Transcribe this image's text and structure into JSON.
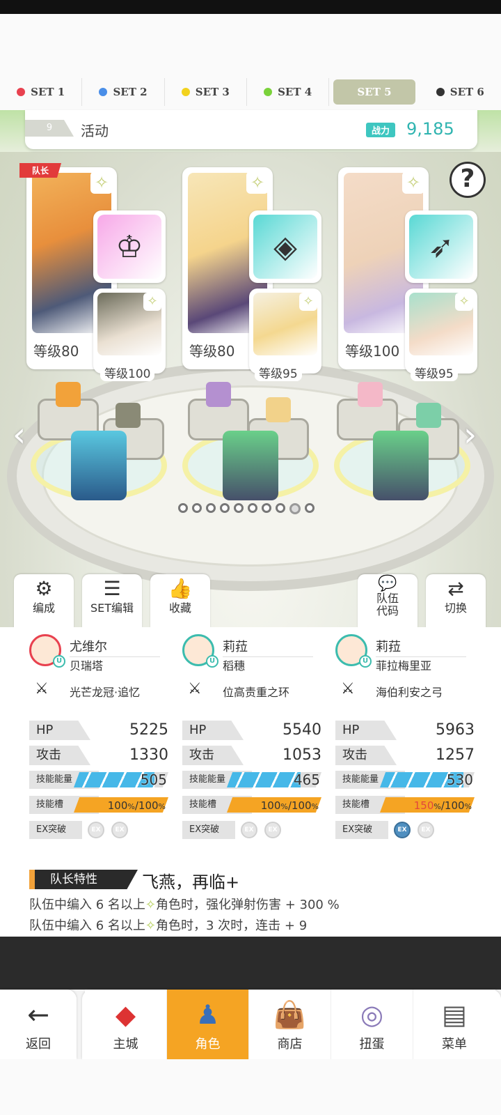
{
  "sets": [
    {
      "label": "SET 1",
      "color": "#e8414f",
      "active": false
    },
    {
      "label": "SET 2",
      "color": "#4a8ee8",
      "active": false
    },
    {
      "label": "SET 3",
      "color": "#f2d21e",
      "active": false
    },
    {
      "label": "SET 4",
      "color": "#7ad23a",
      "active": false
    },
    {
      "label": "SET 5",
      "color": "",
      "active": true
    },
    {
      "label": "SET 6",
      "color": "#333333",
      "active": false
    }
  ],
  "team": {
    "number": "9",
    "name": "活动",
    "power_label": "战力",
    "power_value": "9,185"
  },
  "help_label": "?",
  "leader_badge": "队长",
  "slots": [
    {
      "main_level": "等级80",
      "support_level": "等级100",
      "item_color": "#f7a8e8",
      "item_glyph": "♔"
    },
    {
      "main_level": "等级80",
      "support_level": "等级95",
      "item_color": "#58d8d4",
      "item_glyph": "◈"
    },
    {
      "main_level": "等级100",
      "support_level": "等级95",
      "item_color": "#58d8d4",
      "item_glyph": "➶"
    }
  ],
  "page_dots_total": 10,
  "page_dot_active": 9,
  "tools": {
    "formation": "编成",
    "set_edit": "SET编辑",
    "favorite": "收藏",
    "team_code_1": "队伍",
    "team_code_2": "代码",
    "switch": "切换"
  },
  "stats": [
    {
      "name": "尤维尔",
      "sub": "贝瑞塔",
      "equip": "光芒龙冠·追忆",
      "avatar_border": "#e8414f",
      "hp_label": "HP",
      "hp": "5225",
      "atk_label": "攻击",
      "atk": "1330",
      "skill_label": "技能能量",
      "skill": "505",
      "skill_fill": 0.85,
      "gauge_label": "技能槽",
      "gauge_current": "100",
      "gauge_max": "/100",
      "gauge_unit": "%",
      "gauge_fill": 1.0,
      "ex_label": "EX突破",
      "ex_on": [
        false,
        false
      ]
    },
    {
      "name": "莉菈",
      "sub": "稻穗",
      "equip": "位高责重之环",
      "avatar_border": "#3cbcae",
      "hp_label": "HP",
      "hp": "5540",
      "atk_label": "攻击",
      "atk": "1053",
      "skill_label": "技能能量",
      "skill": "465",
      "skill_fill": 0.78,
      "gauge_label": "技能槽",
      "gauge_current": "100",
      "gauge_max": "/100",
      "gauge_unit": "%",
      "gauge_fill": 1.0,
      "ex_label": "EX突破",
      "ex_on": [
        false,
        false
      ]
    },
    {
      "name": "莉菈",
      "sub": "菲拉梅里亚",
      "equip": "海伯利安之弓",
      "avatar_border": "#3cbcae",
      "hp_label": "HP",
      "hp": "5963",
      "atk_label": "攻击",
      "atk": "1257",
      "skill_label": "技能能量",
      "skill": "530",
      "skill_fill": 0.88,
      "gauge_label": "技能槽",
      "gauge_current": "150",
      "gauge_max": "/100",
      "gauge_unit": "%",
      "gauge_fill": 1.0,
      "ex_label": "EX突破",
      "ex_on": [
        true,
        false
      ]
    }
  ],
  "ex_text": "EX",
  "leader": {
    "tag": "队长特性",
    "title": "飞燕，再临+",
    "lines": [
      {
        "pre": "队伍中编入 6 名以上",
        "post": "角色时，强化弹射伤害 + 300 %"
      },
      {
        "pre": "队伍中编入 6 名以上",
        "post": "角色时，3 次时，连击 + 9"
      }
    ]
  },
  "nav": {
    "back": "返回",
    "items": [
      "主城",
      "角色",
      "商店",
      "扭蛋",
      "菜单"
    ],
    "active": 1
  }
}
